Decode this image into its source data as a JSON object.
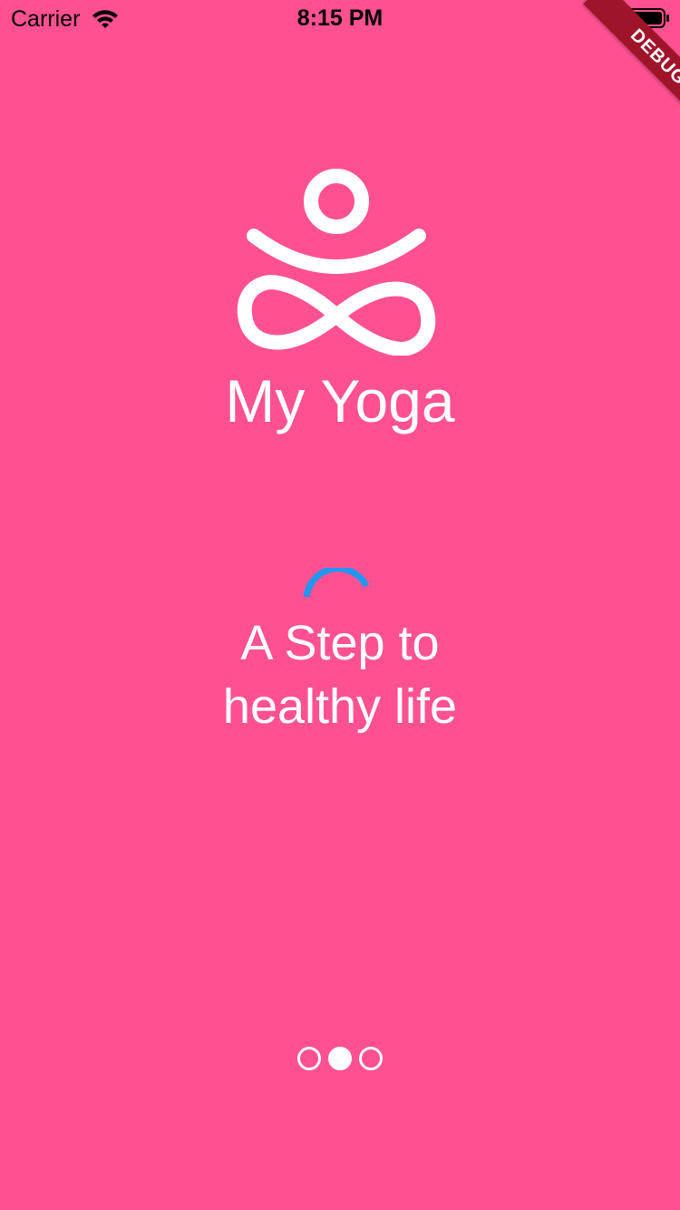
{
  "status_bar": {
    "carrier": "Carrier",
    "time": "8:15 PM",
    "wifi_icon": "wifi-icon",
    "battery_icon": "battery-icon"
  },
  "debug_banner": {
    "label": "DEBUG",
    "color": "#A0142A"
  },
  "theme": {
    "background": "#FF5192",
    "foreground": "#FFFFFF",
    "spinner": "#2196F3"
  },
  "splash": {
    "logo_icon": "yoga-meditation-icon",
    "title": "My Yoga",
    "loading_icon": "loading-spinner-icon",
    "tagline_line1": "A Step to",
    "tagline_line2": "healthy life"
  },
  "pager": {
    "pages": 3,
    "active_index": 1
  }
}
